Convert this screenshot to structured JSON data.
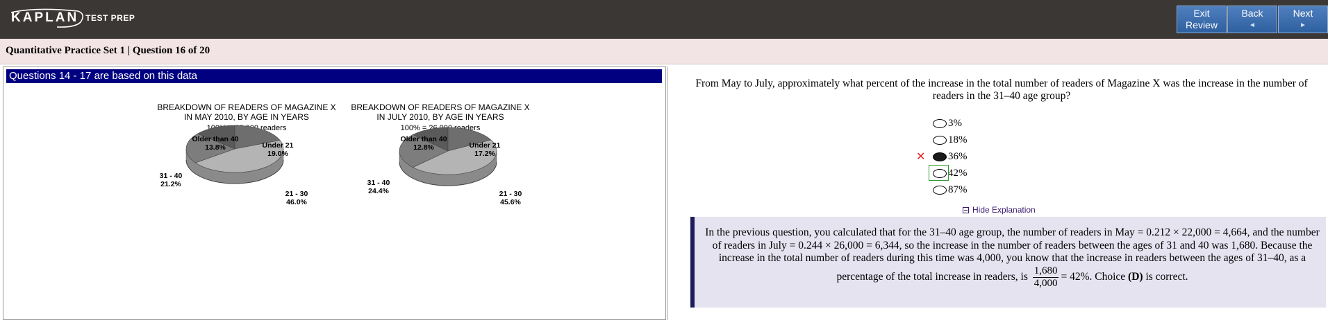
{
  "header": {
    "logo_text": "KAPLAN",
    "logo_sub": "TEST PREP",
    "buttons": [
      {
        "line1": "Exit",
        "line2": "Review",
        "arrow": ""
      },
      {
        "line1": "Back",
        "line2": "",
        "arrow": "◄"
      },
      {
        "line1": "Next",
        "line2": "",
        "arrow": "►"
      }
    ]
  },
  "subbar": {
    "title": "Quantitative Practice Set 1 | Question  16 of 20"
  },
  "left": {
    "header": "Questions 14 - 17 are based on this data",
    "charts": [
      {
        "title_line1": "BREAKDOWN OF READERS OF MAGAZINE X",
        "title_line2": "IN MAY 2010, BY AGE IN YEARS",
        "total": "100% = 22,000 readers",
        "slices": [
          {
            "label": "Older than 40",
            "value": "13.8%"
          },
          {
            "label": "Under 21",
            "value": "19.0%"
          },
          {
            "label": "21 - 30",
            "value": "46.0%"
          },
          {
            "label": "31 - 40",
            "value": "21.2%"
          }
        ]
      },
      {
        "title_line1": "BREAKDOWN OF READERS OF MAGAZINE X",
        "title_line2": "IN JULY 2010, BY AGE IN YEARS",
        "total": "100% = 26,000 readers",
        "slices": [
          {
            "label": "Older than 40",
            "value": "12.8%"
          },
          {
            "label": "Under 21",
            "value": "17.2%"
          },
          {
            "label": "21 - 30",
            "value": "45.6%"
          },
          {
            "label": "31 - 40",
            "value": "24.4%"
          }
        ]
      }
    ]
  },
  "chart_data": [
    {
      "type": "pie",
      "title": "BREAKDOWN OF READERS OF MAGAZINE X IN MAY 2010, BY AGE IN YEARS",
      "subtitle": "100% = 22,000 readers",
      "categories": [
        "Older than 40",
        "Under 21",
        "21 - 30",
        "31 - 40"
      ],
      "values": [
        13.8,
        19.0,
        46.0,
        21.2
      ]
    },
    {
      "type": "pie",
      "title": "BREAKDOWN OF READERS OF MAGAZINE X IN JULY 2010, BY AGE IN YEARS",
      "subtitle": "100% = 26,000 readers",
      "categories": [
        "Older than 40",
        "Under 21",
        "21 - 30",
        "31 - 40"
      ],
      "values": [
        12.8,
        17.2,
        45.6,
        24.4
      ]
    }
  ],
  "question": {
    "stem": "From May to July, approximately what percent of the increase in the total number of readers of Magazine X was the increase in the number of readers in the 31–40 age group?",
    "choices": [
      "3%",
      "18%",
      "36%",
      "42%",
      "87%"
    ],
    "selected_index": 2,
    "correct_index": 3,
    "wrong_mark": "✕",
    "hide_link": "Hide Explanation"
  },
  "explanation": {
    "text_before": "In the previous question, you calculated that for the 31–40 age group, the number of readers in May = 0.212 × 22,000 = 4,664, and the number of readers in July = 0.244 × 26,000 = 6,344, so the increase in the number of readers between the ages of 31 and 40 was 1,680. Because the increase in the total number of readers during this time was 4,000, you know that the increase in readers between the ages of 31–40, as a percentage of the total increase in readers, is",
    "frac_num": "1,680",
    "frac_den": "4,000",
    "text_after": "= 42%.  Choice",
    "choice_letter": "(D)",
    "text_end": "is correct."
  },
  "colors": {
    "topbar": "#3b3735",
    "subbar": "#f2e3e5",
    "header_blue": "#000080",
    "explain_bg": "#e5e3f0",
    "wrong": "#e02020",
    "correct_box": "#2e9a2e"
  }
}
